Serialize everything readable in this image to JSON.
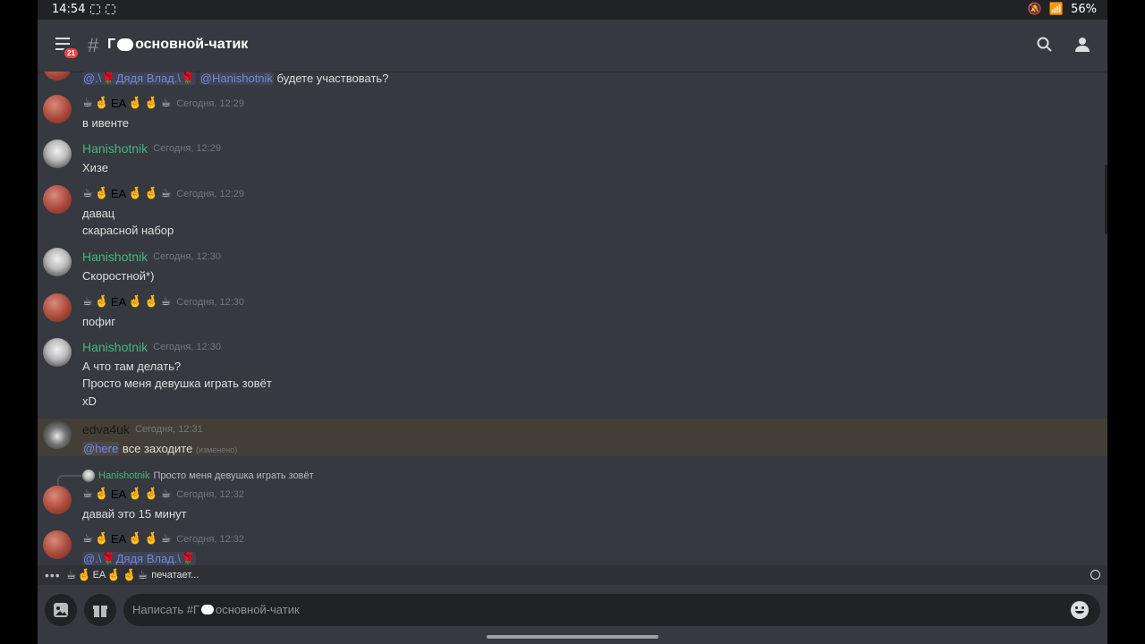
{
  "status_bar": {
    "time": "14:54",
    "battery": "56%"
  },
  "header": {
    "badge_count": "21",
    "channel_prefix": "Г",
    "channel_name": "основной-чатик"
  },
  "messages": {
    "m0": {
      "mention1": "@.\\🌹Дядя Влад.\\🌹",
      "mention2": "@Hanishotnik",
      "text": "будете участвовать?"
    },
    "m1": {
      "ea": "EA",
      "time": "Сегодня, 12:29",
      "text": "в ивенте"
    },
    "m2": {
      "name": "Hanishotnik",
      "time": "Сегодня, 12:29",
      "text": "Хизе"
    },
    "m3": {
      "ea": "EA",
      "time": "Сегодня, 12:29",
      "text1": "давац",
      "text2": "скарасной набор"
    },
    "m4": {
      "name": "Hanishotnik",
      "time": "Сегодня, 12:30",
      "text": "Скоростной*)"
    },
    "m5": {
      "ea": "EA",
      "time": "Сегодня, 12:30",
      "text": "пофиг"
    },
    "m6": {
      "name": "Hanishotnik",
      "time": "Сегодня, 12:30",
      "text1": "А что там делать?",
      "text2": "Просто меня девушка играть зовёт",
      "text3": "xD"
    },
    "m7": {
      "name": "edva4uk",
      "time": "Сегодня, 12:31",
      "mention": "@here",
      "text": "все заходите",
      "edited": "(изменено)"
    },
    "m8": {
      "reply_name": "Hanishotnik",
      "reply_text": "Просто меня девушка играть зовёт",
      "ea": "EA",
      "time": "Сегодня, 12:32",
      "text": "давай это 15 минут"
    },
    "m9": {
      "ea": "EA",
      "time": "Сегодня, 12:32",
      "mention": "@.\\🌹Дядя Влад.\\🌹"
    }
  },
  "typing": {
    "ea": "EA",
    "text": "печатает..."
  },
  "composer": {
    "placeholder_prefix": "Написать #Г",
    "placeholder_suffix": "основной-чатик"
  }
}
